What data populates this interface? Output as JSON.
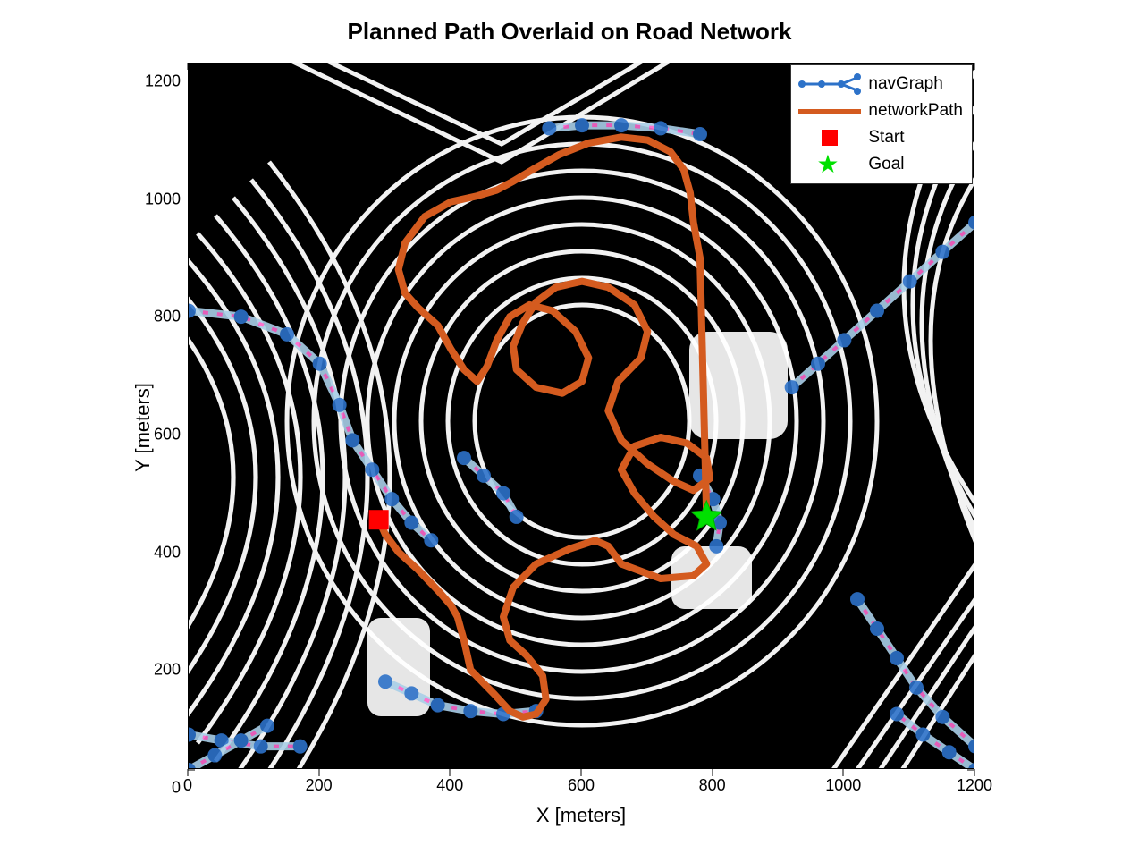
{
  "chart_data": {
    "type": "line",
    "title": "Planned Path Overlaid on Road Network",
    "xlabel": "X [meters]",
    "ylabel": "Y [meters]",
    "xlim": [
      0,
      1200
    ],
    "ylim": [
      0,
      1200
    ],
    "x_ticks": [
      0,
      200,
      400,
      600,
      800,
      1000,
      1200
    ],
    "y_ticks": [
      0,
      200,
      400,
      600,
      800,
      1000,
      1200
    ],
    "legend": [
      "navGraph",
      "networkPath",
      "Start",
      "Goal"
    ],
    "markers": {
      "Start": {
        "x": 290,
        "y": 425,
        "symbol": "square",
        "color": "#ff0000"
      },
      "Goal": {
        "x": 790,
        "y": 430,
        "symbol": "star",
        "color": "#00e000"
      }
    },
    "series": [
      {
        "name": "networkPath",
        "color": "#d45b1f",
        "x": [
          290,
          300,
          320,
          350,
          380,
          400,
          410,
          420,
          430,
          465,
          490,
          510,
          530,
          545,
          540,
          515,
          490,
          480,
          495,
          530,
          580,
          620,
          640,
          660,
          720,
          770,
          790,
          775,
          740,
          710,
          680,
          660,
          680,
          720,
          760,
          790,
          795,
          770,
          740,
          700,
          660,
          640,
          655,
          690,
          700,
          680,
          640,
          600,
          560,
          530,
          510,
          495,
          500,
          530,
          570,
          600,
          610,
          590,
          555,
          520,
          490,
          470,
          455,
          440,
          420,
          400,
          380,
          350,
          330,
          320,
          330,
          360,
          400,
          440,
          470,
          495,
          525,
          565,
          610,
          660,
          700,
          735,
          755,
          765,
          770,
          780,
          790
        ],
        "y": [
          425,
          400,
          370,
          340,
          305,
          280,
          260,
          220,
          170,
          130,
          100,
          90,
          95,
          120,
          160,
          195,
          220,
          260,
          310,
          350,
          375,
          390,
          380,
          350,
          325,
          330,
          350,
          380,
          400,
          430,
          470,
          510,
          550,
          565,
          555,
          530,
          495,
          475,
          490,
          520,
          560,
          610,
          660,
          700,
          745,
          790,
          820,
          830,
          820,
          795,
          760,
          720,
          680,
          650,
          640,
          660,
          700,
          745,
          780,
          790,
          770,
          730,
          685,
          660,
          680,
          715,
          755,
          785,
          810,
          850,
          895,
          940,
          965,
          975,
          985,
          1000,
          1020,
          1045,
          1065,
          1075,
          1070,
          1050,
          1020,
          980,
          930,
          870,
          430
        ]
      }
    ],
    "note": "Background is a binary occupancy map of an open-pit mine with contour lines; navGraph edges (blue dotted network) overlay drivable roads."
  },
  "title": "Planned Path Overlaid on Road Network",
  "xlabel": "X [meters]",
  "ylabel": "Y [meters]",
  "legend": {
    "navGraph": "navGraph",
    "networkPath": "networkPath",
    "start": "Start",
    "goal": "Goal"
  },
  "ticks": {
    "x": [
      "0",
      "200",
      "400",
      "600",
      "800",
      "1000",
      "1200"
    ],
    "y": [
      "0",
      "200",
      "400",
      "600",
      "800",
      "1000",
      "1200"
    ]
  }
}
